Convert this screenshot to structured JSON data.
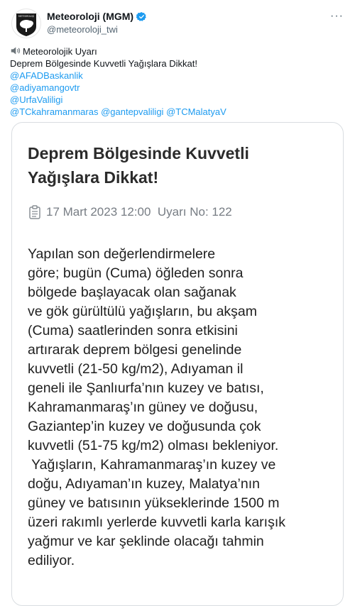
{
  "account": {
    "display_name": "Meteoroloji (MGM)",
    "handle": "@meteoroloji_twi",
    "logo_text": "METEOROLOJİ",
    "verified_icon": "verified-badge-icon"
  },
  "tweet": {
    "title_line": "Meteorolojik Uyarı",
    "headline": "Deprem Bölgesinde Kuvvetli Yağışlara Dikkat!",
    "mentions": [
      "@AFADBaskanlik",
      "@adiyamangovtr",
      "@UrfaValiligi",
      "@TCkahramanmaras",
      "@gantepvaliligi",
      "@TCMalatyaV"
    ]
  },
  "card": {
    "title_lines": [
      "Deprem Bölgesinde Kuvvetli",
      "Yağışlara Dikkat!"
    ],
    "meta": "17 Mart 2023 12:00  Uyarı No: 122",
    "body_lines": [
      "Yapılan son değerlendirmelere",
      "göre; bugün (Cuma) öğleden sonra",
      "bölgede başlayacak olan sağanak",
      "ve gök gürültülü yağışların, bu akşam",
      "(Cuma) saatlerinden sonra etkisini",
      "artırarak deprem bölgesi genelinde",
      "kuvvetli (21-50 kg/m2), Adıyaman il",
      "geneli ile Şanlıurfa’nın kuzey ve batısı,",
      "Kahramanmaraş’ın güney ve doğusu,",
      "Gaziantep’in kuzey ve doğusunda çok",
      "kuvvetli (51-75 kg/m2) olması bekleniyor.",
      " Yağışların, Kahramanmaraş’ın kuzey ve",
      "doğu, Adıyaman’ın kuzey, Malatya’nın",
      "güney ve batısının yükseklerinde 1500 m",
      "üzeri rakımlı yerlerde kuvvetli karla karışık",
      "yağmur ve kar şeklinde olacağı tahmin",
      "ediliyor."
    ]
  },
  "colors": {
    "link": "#1d9bf0",
    "verified": "#1d9bf0",
    "muted": "#536471"
  }
}
